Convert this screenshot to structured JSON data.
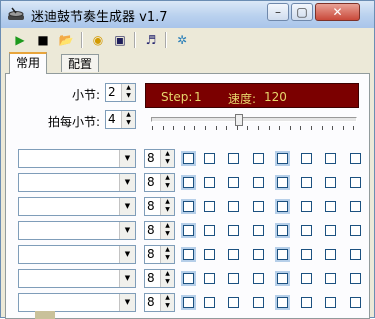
{
  "window": {
    "title": "迷迪鼓节奏生成器 v1.7"
  },
  "titlebar_buttons": [
    {
      "name": "minimize-button",
      "glyph": "–"
    },
    {
      "name": "maximize-button",
      "glyph": "▢"
    },
    {
      "name": "close-button",
      "glyph": "✕"
    }
  ],
  "toolbar": {
    "tools": [
      {
        "name": "play-icon",
        "glyph": "▶",
        "color": "#1e9a1e"
      },
      {
        "name": "stop-icon",
        "glyph": "■",
        "color": "#000000"
      },
      {
        "name": "open-folder-icon",
        "glyph": "📂",
        "color": "#b68a1c"
      },
      {
        "name": "drum-icon",
        "glyph": "◉",
        "color": "#d39a00"
      },
      {
        "name": "save-disk-icon",
        "glyph": "▣",
        "color": "#1e1e5a"
      },
      {
        "name": "midi-keyboard-icon",
        "glyph": "♬",
        "color": "#1d1d6b"
      },
      {
        "name": "settings-fan-icon",
        "glyph": "✲",
        "color": "#2a7fb8"
      }
    ]
  },
  "tabs": [
    {
      "label": "常用",
      "active": true
    },
    {
      "label": "配置",
      "active": false
    }
  ],
  "form": {
    "bars_label": "小节:",
    "bars_value": "2",
    "beats_label": "拍每小节:",
    "beats_value": "4"
  },
  "display": {
    "step_label": "Step:",
    "step_value": "1",
    "tempo_label": "速度:",
    "tempo_value": "120"
  },
  "tempo_slider": {
    "position_fraction": 0.42
  },
  "rows": [
    {
      "instrument": "",
      "steps_value": "8",
      "checks": [
        false,
        false,
        false,
        false,
        false,
        false,
        false,
        false
      ]
    },
    {
      "instrument": "",
      "steps_value": "8",
      "checks": [
        false,
        false,
        false,
        false,
        false,
        false,
        false,
        false
      ]
    },
    {
      "instrument": "",
      "steps_value": "8",
      "checks": [
        false,
        false,
        false,
        false,
        false,
        false,
        false,
        false
      ]
    },
    {
      "instrument": "",
      "steps_value": "8",
      "checks": [
        false,
        false,
        false,
        false,
        false,
        false,
        false,
        false
      ]
    },
    {
      "instrument": "",
      "steps_value": "8",
      "checks": [
        false,
        false,
        false,
        false,
        false,
        false,
        false,
        false
      ]
    },
    {
      "instrument": "",
      "steps_value": "8",
      "checks": [
        false,
        false,
        false,
        false,
        false,
        false,
        false,
        false
      ]
    },
    {
      "instrument": "",
      "steps_value": "8",
      "checks": [
        false,
        false,
        false,
        false,
        false,
        false,
        false,
        false
      ]
    }
  ],
  "highlight_columns": [
    0,
    4
  ],
  "colors": {
    "display_bg": "#7b0000",
    "display_text": "#e7d56c"
  }
}
